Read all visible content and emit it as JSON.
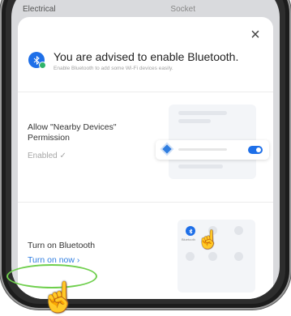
{
  "background": {
    "left_label": "Electrical",
    "right_label": "Socket"
  },
  "dialog": {
    "title": "You are advised to enable Bluetooth.",
    "subtitle": "Enable Bluetooth to add some Wi-Fi devices easily.",
    "close_icon": "×"
  },
  "permission": {
    "label": "Allow \"Nearby Devices\" Permission",
    "status": "Enabled ✓"
  },
  "bluetooth": {
    "label": "Turn on Bluetooth",
    "action": "Turn on now ›",
    "preview_caption": "Bluetooth"
  },
  "colors": {
    "accent": "#1e6fe8",
    "link": "#2f7de0",
    "highlight": "#6fcf4d"
  }
}
